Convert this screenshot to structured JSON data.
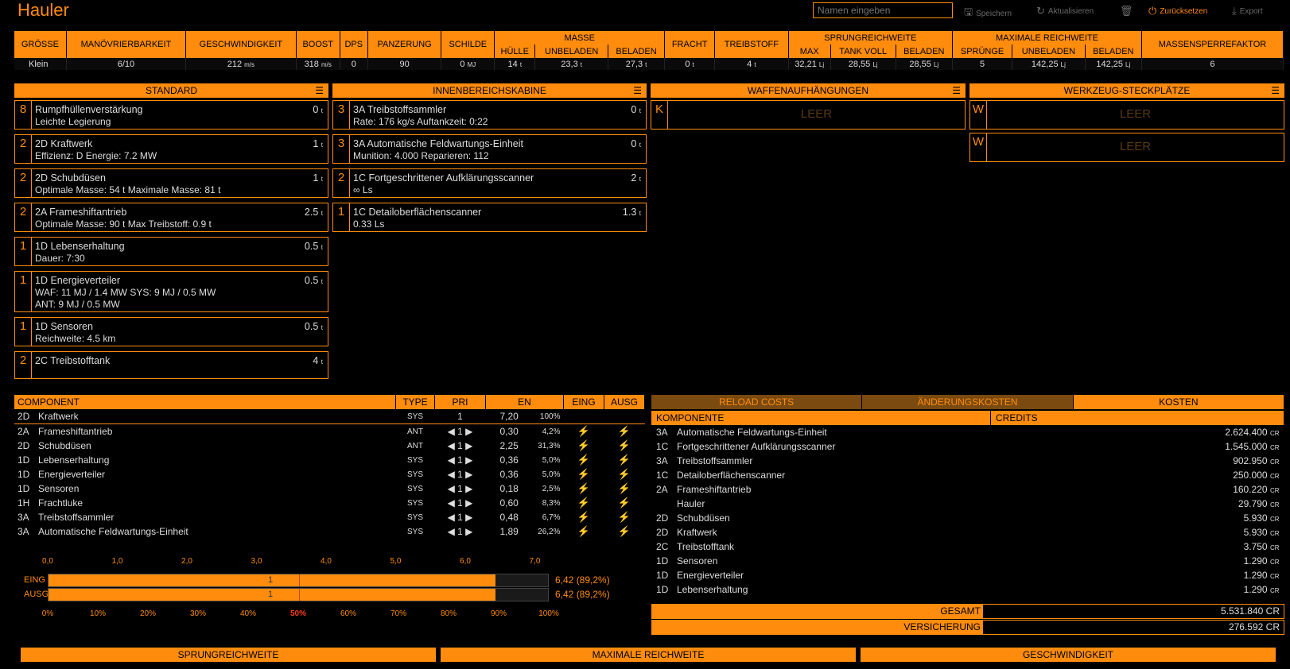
{
  "app": {
    "title": "Hauler"
  },
  "toolbar": {
    "name_placeholder": "Namen eingeben",
    "save_label": "Speichern",
    "refresh_label": "Aktualisieren",
    "reset_label": "Zurücksetzen",
    "export_label": "Export"
  },
  "stats": {
    "headers": {
      "size": "GRÖSSE",
      "maneuver": "MANÖVRIERBARKEIT",
      "speed": "GESCHWINDIGKEIT",
      "boost": "BOOST",
      "dps": "DPS",
      "armour": "PANZERUNG",
      "shields": "SCHILDE",
      "mass": "MASSE",
      "hull": "HÜLLE",
      "unladen": "UNBELADEN",
      "laden": "BELADEN",
      "cargo": "FRACHT",
      "fuel": "TREIBSTOFF",
      "jump": "SPRUNGREICHWEITE",
      "max": "MAX",
      "full_tank": "TANK VOLL",
      "jump_laden": "BELADEN",
      "total_range": "MAXIMALE REICHWEITE",
      "jumps": "SPRÜNGE",
      "range_unladen": "UNBELADEN",
      "range_laden": "BELADEN",
      "mass_lock": "MASSENSPERREFAKTOR"
    },
    "values": {
      "size": "Klein",
      "maneuver": "6/10",
      "speed": "212",
      "speed_unit": "m/s",
      "boost": "318",
      "boost_unit": "m/s",
      "dps": "0",
      "armour": "90",
      "shields": "0",
      "shields_unit": "MJ",
      "hull": "14",
      "unladen": "23,3",
      "laden": "27,3",
      "cargo": "0",
      "fuel": "4",
      "ton": "t",
      "jump_max": "32,21",
      "jump_full": "28,55",
      "jump_laden": "28,55",
      "ly": "Lj",
      "jumps": "5",
      "range_unladen": "142,25",
      "range_laden": "142,25",
      "mass_lock": "6"
    }
  },
  "sections": {
    "standard": "STANDARD",
    "internal": "INNENBEREICHSKABINE",
    "hardpoints": "WAFFENAUFHÄNGUNGEN",
    "utility": "WERKZEUG-STECKPLÄTZE"
  },
  "standard_slots": [
    {
      "cls": "8",
      "name": "Rumpfhüllenverstärkung",
      "mass": "0",
      "unit": "t",
      "lines": [
        "Leichte Legierung"
      ]
    },
    {
      "cls": "2",
      "name": "2D Kraftwerk",
      "mass": "1",
      "unit": "t",
      "lines": [
        "Effizienz: D  Energie: 7.2 MW"
      ]
    },
    {
      "cls": "2",
      "name": "2D Schubdüsen",
      "mass": "1",
      "unit": "t",
      "lines": [
        "Optimale Masse: 54 t  Maximale Masse: 81 t"
      ]
    },
    {
      "cls": "2",
      "name": "2A Frameshiftantrieb",
      "mass": "2.5",
      "unit": "t",
      "lines": [
        "Optimale Masse: 90 t  Max Treibstoff: 0.9 t"
      ]
    },
    {
      "cls": "1",
      "name": "1D Lebenserhaltung",
      "mass": "0.5",
      "unit": "t",
      "lines": [
        "Dauer: 7:30"
      ]
    },
    {
      "cls": "1",
      "name": "1D Energieverteiler",
      "mass": "0.5",
      "unit": "t",
      "lines": [
        "WAF: 11 MJ / 1.4 MW  SYS: 9 MJ / 0.5 MW",
        "ANT: 9 MJ / 0.5 MW"
      ]
    },
    {
      "cls": "1",
      "name": "1D Sensoren",
      "mass": "0.5",
      "unit": "t",
      "lines": [
        "Reichweite: 4.5 km"
      ]
    },
    {
      "cls": "2",
      "name": "2C Treibstofftank",
      "mass": "4",
      "unit": "t",
      "lines": []
    }
  ],
  "internal_slots": [
    {
      "cls": "3",
      "name": "3A Treibstoffsammler",
      "mass": "0",
      "unit": "t",
      "lines": [
        "Rate: 176 kg/s  Auftankzeit: 0:22"
      ]
    },
    {
      "cls": "3",
      "name": "3A Automatische Feldwartungs-Einheit",
      "mass": "0",
      "unit": "t",
      "lines": [
        "Munition: 4.000  Reparieren: 112"
      ]
    },
    {
      "cls": "2",
      "name": "1C Fortgeschrittener Aufklärungsscanner",
      "mass": "2",
      "unit": "t",
      "lines": [
        "∞ Ls"
      ]
    },
    {
      "cls": "1",
      "name": "1C Detailoberflächenscanner",
      "mass": "1.3",
      "unit": "t",
      "lines": [
        "0.33 Ls"
      ]
    }
  ],
  "hardpoint_slots": [
    {
      "cls": "K",
      "label": "LEER"
    }
  ],
  "utility_slots": [
    {
      "cls": "W",
      "label": "LEER"
    },
    {
      "cls": "W",
      "label": "LEER"
    }
  ],
  "power": {
    "headers": {
      "component": "COMPONENT",
      "type": "TYPE",
      "pri": "PRI",
      "en": "EN",
      "ret": "EING",
      "dep": "AUSG"
    },
    "rows": [
      {
        "cls": "2D",
        "name": "Kraftwerk",
        "type": "SYS",
        "pri": "1",
        "en": "7,20",
        "pct": "100%",
        "arrows": false,
        "bolts": false
      },
      {
        "cls": "2A",
        "name": "Frameshiftantrieb",
        "type": "ANT",
        "pri": "1",
        "en": "0,30",
        "pct": "4,2%",
        "arrows": true,
        "bolts": true
      },
      {
        "cls": "2D",
        "name": "Schubdüsen",
        "type": "ANT",
        "pri": "1",
        "en": "2,25",
        "pct": "31,3%",
        "arrows": true,
        "bolts": true
      },
      {
        "cls": "1D",
        "name": "Lebenserhaltung",
        "type": "SYS",
        "pri": "1",
        "en": "0,36",
        "pct": "5,0%",
        "arrows": true,
        "bolts": true
      },
      {
        "cls": "1D",
        "name": "Energieverteiler",
        "type": "SYS",
        "pri": "1",
        "en": "0,36",
        "pct": "5,0%",
        "arrows": true,
        "bolts": true
      },
      {
        "cls": "1D",
        "name": "Sensoren",
        "type": "SYS",
        "pri": "1",
        "en": "0,18",
        "pct": "2,5%",
        "arrows": true,
        "bolts": true
      },
      {
        "cls": "1H",
        "name": "Frachtluke",
        "type": "SYS",
        "pri": "1",
        "en": "0,60",
        "pct": "8,3%",
        "arrows": true,
        "bolts": true
      },
      {
        "cls": "3A",
        "name": "Treibstoffsammler",
        "type": "SYS",
        "pri": "1",
        "en": "0,48",
        "pct": "6,7%",
        "arrows": true,
        "bolts": true
      },
      {
        "cls": "3A",
        "name": "Automatische Feldwartungs-Einheit",
        "type": "SYS",
        "pri": "1",
        "en": "1,89",
        "pct": "26,2%",
        "arrows": true,
        "bolts": true
      }
    ],
    "axis_mw": [
      "0,0",
      "1,0",
      "2,0",
      "3,0",
      "4,0",
      "5,0",
      "6,0",
      "7,0"
    ],
    "axis_pct": [
      "0%",
      "10%",
      "20%",
      "30%",
      "40%",
      "50%",
      "60%",
      "70%",
      "80%",
      "90%",
      "100%"
    ],
    "highlight_pct": "50%",
    "bars": [
      {
        "label": "EING",
        "inner": "1",
        "value": "6,42 (89,2%)",
        "fraction": 0.892
      },
      {
        "label": "AUSG",
        "inner": "1",
        "value": "6,42 (89,2%)",
        "fraction": 0.892
      }
    ]
  },
  "costs": {
    "tabs": [
      "RELOAD COSTS",
      "ÄNDERUNGSKOSTEN",
      "KOSTEN"
    ],
    "headers": {
      "component": "KOMPONENTE",
      "credits": "CREDITS"
    },
    "rows": [
      {
        "cls": "3A",
        "name": "Automatische Feldwartungs-Einheit",
        "value": "2.624.400"
      },
      {
        "cls": "1C",
        "name": "Fortgeschrittener Aufklärungsscanner",
        "value": "1.545.000"
      },
      {
        "cls": "3A",
        "name": "Treibstoffsammler",
        "value": "902.950"
      },
      {
        "cls": "1C",
        "name": "Detailoberflächenscanner",
        "value": "250.000"
      },
      {
        "cls": "2A",
        "name": "Frameshiftantrieb",
        "value": "160.220"
      },
      {
        "cls": "",
        "name": "Hauler",
        "value": "29.790"
      },
      {
        "cls": "2D",
        "name": "Schubdüsen",
        "value": "5.930"
      },
      {
        "cls": "2D",
        "name": "Kraftwerk",
        "value": "5.930"
      },
      {
        "cls": "2C",
        "name": "Treibstofftank",
        "value": "3.750"
      },
      {
        "cls": "1D",
        "name": "Sensoren",
        "value": "1.290"
      },
      {
        "cls": "1D",
        "name": "Energieverteiler",
        "value": "1.290"
      },
      {
        "cls": "1D",
        "name": "Lebenserhaltung",
        "value": "1.290"
      }
    ],
    "unit": "CR",
    "total_label": "GESAMT",
    "total_value": "5.531.840 CR",
    "insurance_label": "VERSICHERUNG",
    "insurance_value": "276.592 CR"
  },
  "footer": [
    "SPRUNGREICHWEITE",
    "MAXIMALE REICHWEITE",
    "GESCHWINDIGKEIT"
  ]
}
